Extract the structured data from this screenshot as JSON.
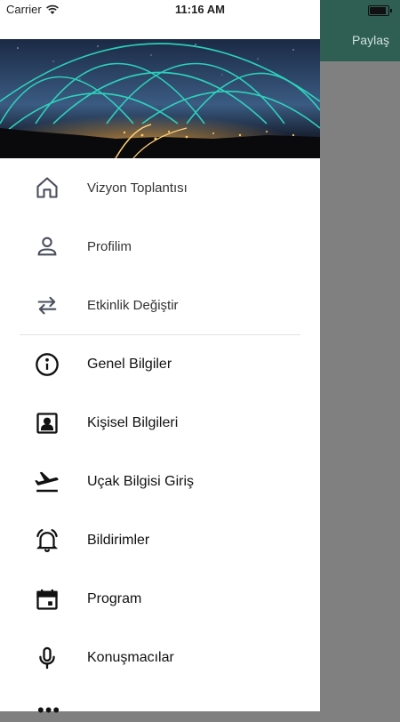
{
  "status": {
    "carrier": "Carrier",
    "time": "11:16 AM",
    "battery_level": 0.9
  },
  "appbar": {
    "share_label": "Paylaş",
    "color": "#2f5e53"
  },
  "menu": {
    "top_items": [
      {
        "label": "Vizyon Toplantısı",
        "icon": "home-icon"
      },
      {
        "label": "Profilim",
        "icon": "person-icon"
      },
      {
        "label": "Etkinlik Değiştir",
        "icon": "swap-icon"
      }
    ],
    "items": [
      {
        "label": "Genel Bilgiler",
        "icon": "info-icon"
      },
      {
        "label": "Kişisel Bilgileri",
        "icon": "contact-card-icon"
      },
      {
        "label": "Uçak Bilgisi Giriş",
        "icon": "airplane-takeoff-icon"
      },
      {
        "label": "Bildirimler",
        "icon": "bell-ringing-icon"
      },
      {
        "label": "Program",
        "icon": "calendar-icon"
      },
      {
        "label": "Konuşmacılar",
        "icon": "microphone-icon"
      }
    ],
    "more": "•••"
  }
}
